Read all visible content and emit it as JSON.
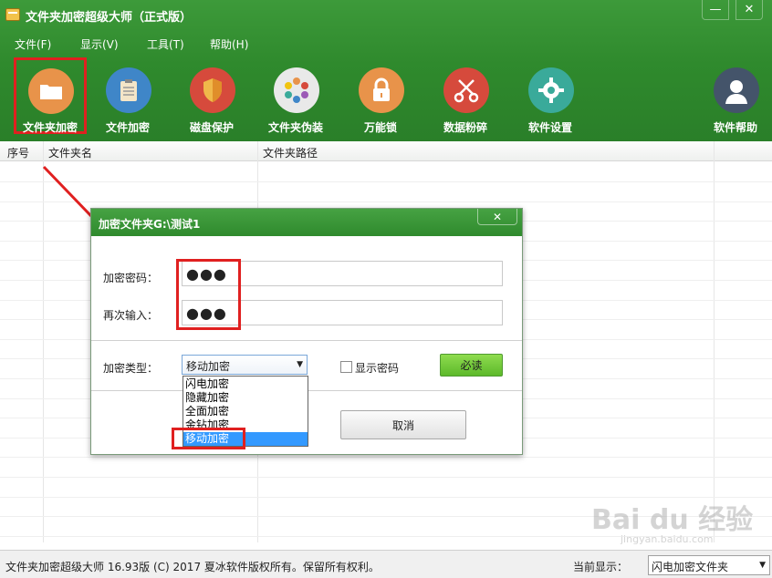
{
  "app": {
    "title": "文件夹加密超级大师（正式版）",
    "minimize": "—",
    "close": "✕"
  },
  "menu": [
    {
      "label": "文件(F)"
    },
    {
      "label": "显示(V)"
    },
    {
      "label": "工具(T)"
    },
    {
      "label": "帮助(H)"
    }
  ],
  "toolbar": [
    {
      "label": "文件夹加密",
      "icon": "folder-icon",
      "color": "#e8934a",
      "glyph": "▭"
    },
    {
      "label": "文件加密",
      "icon": "document-icon",
      "color": "#3f86c8",
      "glyph": "▤"
    },
    {
      "label": "磁盘保护",
      "icon": "shield-icon",
      "color": "#d64a3c",
      "glyph": "⛉"
    },
    {
      "label": "文件夹伪装",
      "icon": "color-wheel-icon",
      "color": "#e9e9e9",
      "glyph": "✺"
    },
    {
      "label": "万能锁",
      "icon": "lock-icon",
      "color": "#e8934a",
      "glyph": "🔒"
    },
    {
      "label": "数据粉碎",
      "icon": "scissors-icon",
      "color": "#d64a3c",
      "glyph": "✂"
    },
    {
      "label": "软件设置",
      "icon": "gear-icon",
      "color": "#3aaa9a",
      "glyph": "⚙"
    },
    {
      "label": "软件帮助",
      "icon": "user-icon",
      "color": "#44546a",
      "glyph": "●"
    }
  ],
  "table": {
    "columns": [
      "序号",
      "文件夹名",
      "文件夹路径"
    ]
  },
  "dialog": {
    "title": "加密文件夹G:\\测试1",
    "close": "✕",
    "password_label": "加密密码：",
    "password_value": "●●●",
    "confirm_label": "再次输入：",
    "confirm_value": "●●●",
    "type_label": "加密类型：",
    "type_selected": "移动加密",
    "show_password_label": "显示密码",
    "must_read_button": "必读",
    "cancel_button": "取消",
    "type_options": [
      "闪电加密",
      "隐藏加密",
      "全面加密",
      "金钻加密",
      "移动加密"
    ]
  },
  "status": {
    "text": "文件夹加密超级大师 16.93版 (C) 2017  夏冰软件版权所有。保留所有权利。",
    "current_label": "当前显示：",
    "current_value": "闪电加密文件夹"
  },
  "watermark": {
    "main": "Bai du 经验",
    "sub": "jingyan.baidu.com"
  },
  "colors": {
    "header_green": "#2f8a2d",
    "highlight_red": "#e02020",
    "selection_blue": "#3399ff"
  }
}
